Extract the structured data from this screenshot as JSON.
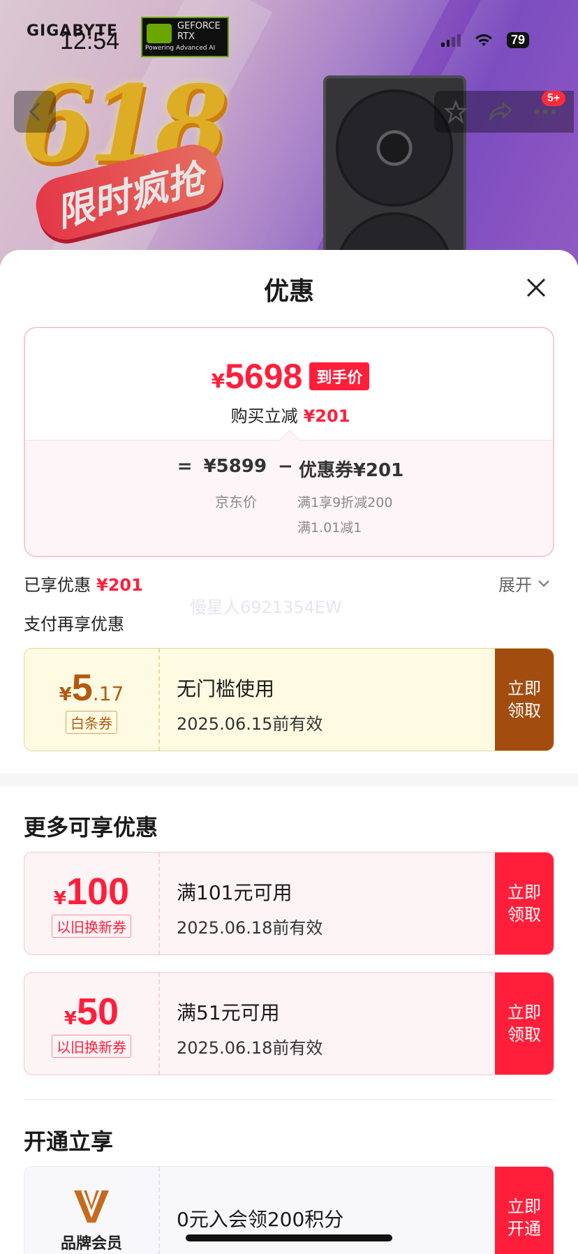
{
  "status_bar": {
    "time": "12:54",
    "battery": "79"
  },
  "banner": {
    "brand": "GIGABYTE",
    "rtx_badge": [
      "GEFORCE",
      "RTX"
    ],
    "rtx_sub": "Powering Advanced AI",
    "promo_618": "618",
    "promo_slogan": "限时疯抢",
    "cart_count": "5+"
  },
  "sheet": {
    "title": "优惠",
    "price_card": {
      "currency": "¥",
      "final_price": "5698",
      "final_tag": "到手价",
      "save_label": "购买立减",
      "save_amount": "¥201",
      "formula": {
        "eq": "=",
        "jd_price": "¥5899",
        "minus": "−",
        "coupon": "优惠券¥201"
      },
      "jd_label": "京东价",
      "coupon_rule_1": "满1享9折减200",
      "coupon_rule_2": "满1.01减1"
    },
    "enjoyed_label": "已享优惠",
    "enjoyed_amount": "¥201",
    "expand_label": "展开",
    "watermark": "慢星人6921354EW",
    "pay_more_label": "支付再享优惠",
    "baitiao_coupon": {
      "currency": "¥",
      "amount_int": "5",
      "amount_dec": ".17",
      "type": "白条券",
      "title": "无门槛使用",
      "valid": "2025.06.15前有效",
      "action": "立即领取"
    },
    "more_title": "更多可享优惠",
    "coupons": [
      {
        "currency": "¥",
        "amount": "100",
        "type": "以旧换新券",
        "title": "满101元可用",
        "valid": "2025.06.18前有效",
        "action": "立即领取"
      },
      {
        "currency": "¥",
        "amount": "50",
        "type": "以旧换新券",
        "title": "满51元可用",
        "valid": "2025.06.18前有效",
        "action": "立即领取"
      }
    ],
    "member_title": "开通立享",
    "member": {
      "label": "品牌会员",
      "title": "0元入会领200积分",
      "action": "立即开通"
    }
  },
  "colors": {
    "accent_red": "#ff1f3a",
    "baitiao_brown": "#a24c0f"
  }
}
